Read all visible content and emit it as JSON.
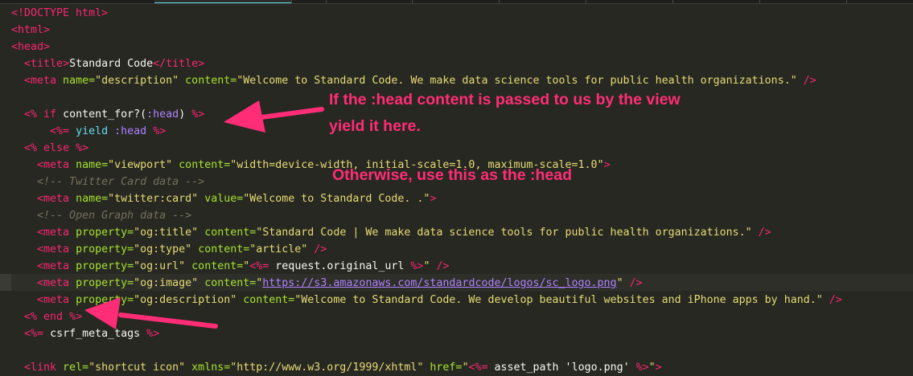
{
  "annotations": {
    "note1_line1": "If the :head content is passed to us by the view",
    "note1_line2": "yield it here.",
    "note2": "Otherwise, use this as the :head",
    "arrow_color": "#ff2d76"
  },
  "code": {
    "doctype": "<!DOCTYPE html>",
    "html_open": "<html>",
    "head_open": "<head>",
    "title_open": "<title>",
    "title_text": "Standard Code",
    "title_close": "</title>",
    "meta": "<meta",
    "close_slash": " />",
    "close_gt": ">",
    "name_attr": " name=",
    "content_attr": " content=",
    "property_attr": " property=",
    "value_attr": " value=",
    "description_val": "\"description\"",
    "description_content": "\"Welcome to Standard Code. We make data science tools for public health organizations.\"",
    "erb_open": "<%",
    "erb_open_eq": "<%=",
    "erb_close": "%>",
    "if_kw": "if",
    "content_for": "content_for?(",
    "head_sym": ":head",
    "paren_close": ")",
    "yield_kw": "yield",
    "else_kw": "else",
    "end_kw": "end",
    "viewport_val": "\"viewport\"",
    "viewport_content": "\"width=device-width, initial-scale=1.0, maximum-scale=1.0\"",
    "comment_twitter": "<!-- Twitter Card data -->",
    "twitter_card_val": "\"twitter:card\"",
    "twitter_card_value": "\"Welcome to Standard Code. .\"",
    "comment_og": "<!-- Open Graph data -->",
    "og_title_prop": "\"og:title\"",
    "og_title_content": "\"Standard Code | We make data science tools for public health organizations.\"",
    "og_type_prop": "\"og:type\"",
    "og_type_content": "\"article\"",
    "og_url_prop": "\"og:url\"",
    "quote": "\"",
    "request_url": "request.original_url",
    "og_image_prop": "\"og:image\"",
    "og_image_url": "https://s3.amazonaws.com/standardcode/logos/sc_logo.png",
    "og_desc_prop": "\"og:description\"",
    "og_desc_content": "\"Welcome to Standard Code. We develop beautiful websites and iPhone apps by hand.\"",
    "csrf": "csrf_meta_tags",
    "link_open": "<link",
    "rel_attr": " rel=",
    "rel_val": "\"shortcut icon\"",
    "xmlns_attr": " xmlns=",
    "xmlns_val": "\"http://www.w3.org/1999/xhtml\"",
    "href_attr": " href=",
    "asset_path": "asset_path 'logo.png'"
  }
}
